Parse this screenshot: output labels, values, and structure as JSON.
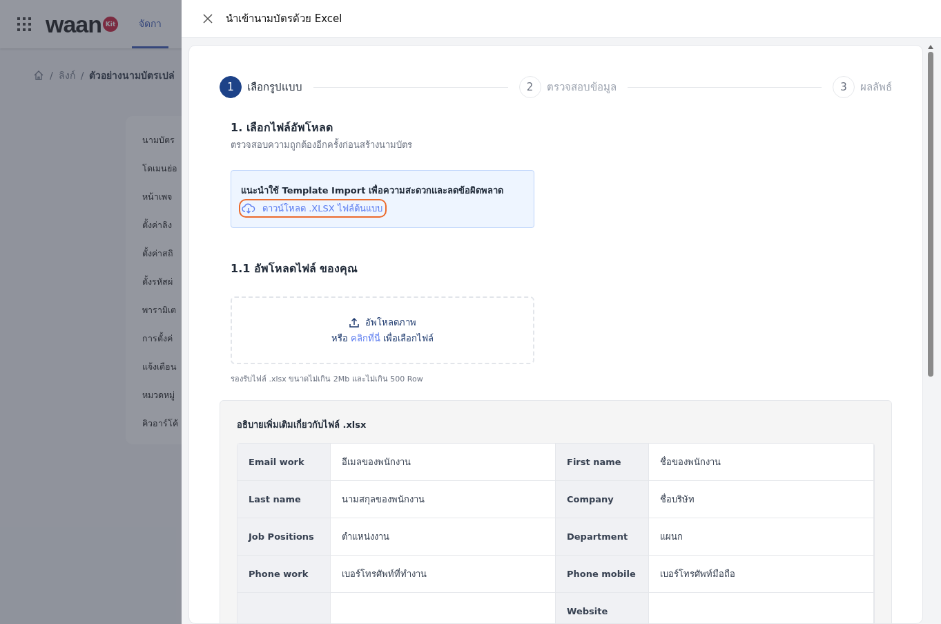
{
  "app_bar": {
    "logo": "waan",
    "logo_badge": "Kit",
    "tabs": [
      {
        "label": "จัดกา",
        "selected": true
      }
    ]
  },
  "breadcrumb": {
    "separator": "/",
    "items": [
      "ลิงก์",
      "ตัวอย่างนามบัตรเปล่"
    ]
  },
  "sidebar": {
    "items": [
      "นามบัตร",
      "โดเมนย่อ",
      "หน้าเพจ",
      "ตั้งค่าลิง",
      "ตั้งค่าสถิ",
      "ตั้งรหัสผ่",
      "พารามิเต",
      "การตั้งค่",
      "แจ้งเตือน",
      "หมวดหมู่",
      "คิวอาร์โค้"
    ]
  },
  "drawer": {
    "title": "นำเข้านามบัตรด้วย Excel",
    "steps": [
      {
        "number": "1",
        "label": "เลือกรูปแบบ",
        "selected": true
      },
      {
        "number": "2",
        "label": "ตรวจสอบข้อมูล",
        "selected": false
      },
      {
        "number": "3",
        "label": "ผลลัพธ์",
        "selected": false
      }
    ],
    "section_title": "1. เลือกไฟล์อัพโหลด",
    "section_subtitle": "ตรวจสอบความถูกต้องอีกครั้งก่อนสร้างนามบัตร",
    "notice": {
      "text": "แนะนำใช้ Template Import เพื่อความสะดวกและลดข้อผิดพลาด",
      "link": "ดาวน์โหลด .XLSX ไฟล์ต้นแบบ",
      "highlighted": true
    },
    "upload_title": "1.1 อัพโหลดไฟล์ ของคุณ",
    "dropzone": {
      "label": "อัพโหลดภาพ",
      "prefix": "หรือ",
      "link": "คลิกที่นี่",
      "suffix": "เพื่อเลือกไฟล์"
    },
    "hint": "รองรับไฟล์ .xlsx ขนาดไม่เกิน 2Mb และไม่เกิน 500 Row",
    "info": {
      "title": "อธิบายเพิ่มเติมเกี่ยวกับไฟล์ .xlsx",
      "rows": [
        {
          "label_1": "Email work",
          "value_1": "อีเมลของพนักงาน",
          "label_2": "First name",
          "value_2": "ชื่อของพนักงาน"
        },
        {
          "label_1": "Last name",
          "value_1": "นามสกุลของพนักงาน",
          "label_2": "Company",
          "value_2": "ชื่อบริษัท"
        },
        {
          "label_1": "Job Positions",
          "value_1": "ตำแหน่งงาน",
          "label_2": "Department",
          "value_2": "แผนก"
        },
        {
          "label_1": "Phone work",
          "value_1": "เบอร์โทรศัพท์ที่ทำงาน",
          "label_2": "Phone mobile",
          "value_2": "เบอร์โทรศัพท์มือถือ"
        },
        {
          "label_2": "Website"
        }
      ]
    }
  }
}
